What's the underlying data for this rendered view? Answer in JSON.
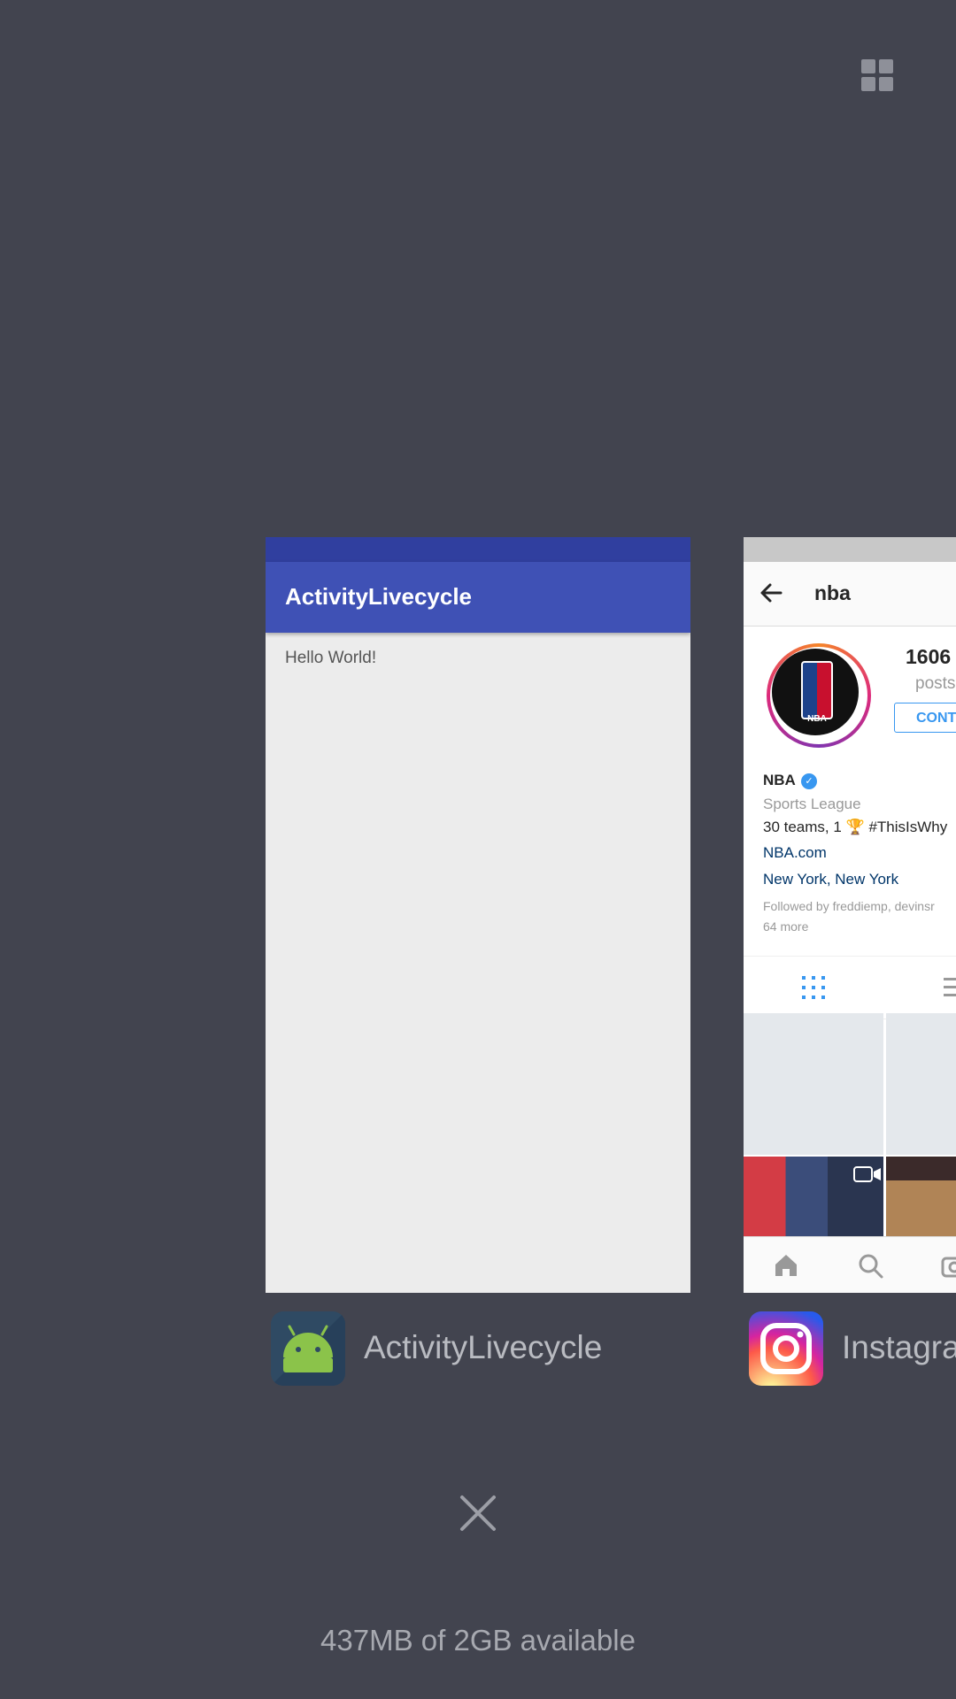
{
  "cards": {
    "activity": {
      "app_name": "ActivityLivecycle",
      "toolbar_title": "ActivityLivecycle",
      "content_text": "Hello World!"
    },
    "instagram": {
      "app_name": "Instagram",
      "label_visible": "Instagra",
      "username": "nba",
      "posts_count": "1606",
      "posts_label": "posts",
      "contact_button": "CONT",
      "profile_name": "NBA",
      "category": "Sports League",
      "bio": "30 teams, 1 🏆 #ThisIsWhy",
      "website": "NBA.com",
      "location": "New York, New York",
      "followed_by_line1": "Followed by freddiemp, devinsr",
      "followed_by_line2": "64 more",
      "avatar_text": "NBA"
    }
  },
  "footer": {
    "memory_status": "437MB of 2GB available"
  },
  "icons": {
    "grid_toggle": "grid-view-icon",
    "close_all": "close-icon",
    "android": "android-icon",
    "instagram": "instagram-icon"
  },
  "colors": {
    "background": "#42444f",
    "activity_toolbar": "#3f51b5",
    "activity_status": "#303f9f",
    "instagram_blue": "#3897f0"
  }
}
